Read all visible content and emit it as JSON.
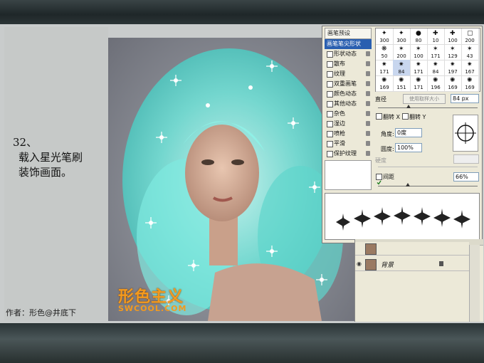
{
  "tutorial": {
    "step_lines": [
      "32、",
      "载入星光笔刷",
      "装饰画面。"
    ],
    "author": "作者：形色@井底下"
  },
  "watermark": {
    "brand": "形色主义",
    "url": "SWCOOL.COM",
    "color": "#f39a1e"
  },
  "brushes_panel": {
    "presets_header": "画笔预设",
    "selected_item": "画笔笔尖形状",
    "options": [
      {
        "label": "形状动态",
        "checked": false
      },
      {
        "label": "散布",
        "checked": false
      },
      {
        "label": "纹理",
        "checked": false
      },
      {
        "label": "双重画笔",
        "checked": false
      },
      {
        "label": "颜色动态",
        "checked": false
      },
      {
        "label": "其他动态",
        "checked": false
      },
      {
        "label": "杂色",
        "checked": false
      },
      {
        "label": "湿边",
        "checked": false
      },
      {
        "label": "喷枪",
        "checked": false
      },
      {
        "label": "平滑",
        "checked": false
      },
      {
        "label": "保护纹理",
        "checked": false
      }
    ],
    "brush_sizes": [
      [
        "300",
        "300",
        "80",
        "10",
        "100",
        "200"
      ],
      [
        "50",
        "200",
        "100",
        "171",
        "129",
        "43"
      ],
      [
        "171",
        "84",
        "171",
        "84",
        "197",
        "167"
      ],
      [
        "169",
        "151",
        "171",
        "196",
        "169",
        "169"
      ]
    ],
    "diameter_label": "直径",
    "sample_size_button": "使用取样大小",
    "diameter_value": "84 px",
    "flip_x_label": "翻转 X",
    "flip_y_label": "翻转 Y",
    "angle_label": "角度:",
    "angle_value": "0度",
    "roundness_label": "圆度:",
    "roundness_value": "100%",
    "hardness_label": "硬度",
    "spacing_label": "间距",
    "spacing_checked": true,
    "spacing_value": "66%"
  },
  "layers_panel": {
    "layer_name": "背景"
  }
}
